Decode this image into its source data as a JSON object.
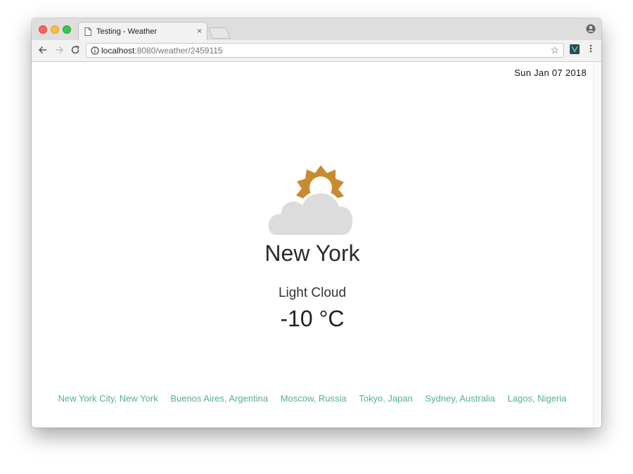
{
  "browser": {
    "tab_title": "Testing - Weather",
    "tab_close": "×",
    "url_host": "localhost",
    "url_path": ":8080/weather/2459115",
    "icons": {
      "page": "doc-icon",
      "close": "close-icon",
      "profile": "profile-icon",
      "back": "back-arrow-icon",
      "forward": "forward-arrow-icon",
      "reload": "reload-icon",
      "info": "info-icon",
      "bookmark": "star-icon",
      "extension": "vue-devtools-icon",
      "menu": "kebab-menu-icon"
    }
  },
  "page": {
    "date": "Sun Jan 07 2018",
    "icon": "partly-cloudy-icon",
    "city": "New York",
    "condition": "Light Cloud",
    "temperature": "-10 °C",
    "links": [
      "New York City, New York",
      "Buenos Aires, Argentina",
      "Moscow, Russia",
      "Tokyo, Japan",
      "Sydney, Australia",
      "Lagos, Nigeria"
    ]
  },
  "colors": {
    "accent_link": "#4fb386",
    "sun": "#c98b30",
    "cloud": "#dcdcdc"
  }
}
